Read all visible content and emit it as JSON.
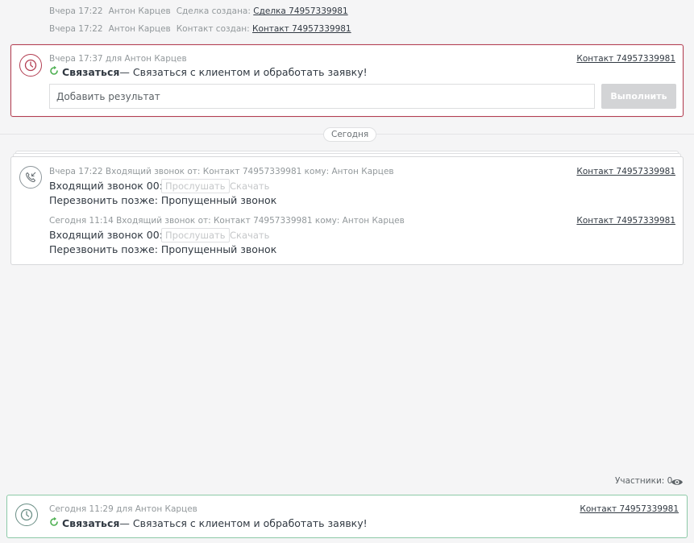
{
  "log": [
    {
      "time": "Вчера 17:22",
      "author": "Антон Карцев",
      "text": "Сделка создана:",
      "link": "Сделка 74957339981"
    },
    {
      "time": "Вчера 17:22",
      "author": "Антон Карцев",
      "text": "Контакт создан:",
      "link": "Контакт 74957339981"
    }
  ],
  "overdue_task": {
    "meta": "Вчера 17:37 для Антон Карцев",
    "contact": "Контакт 74957339981",
    "type": "Связаться",
    "text": " — Связаться с клиентом и обработать заявку!",
    "input_placeholder": "Добавить результат",
    "done_label": "Выполнить"
  },
  "date_separator": "Сегодня",
  "calls": [
    {
      "meta": "Вчера 17:22 Входящий звонок от: Контакт 74957339981 кому: Антон Карцев",
      "contact": "Контакт 74957339981",
      "line": "Входящий звонок 00:00",
      "listen": "Прослушать",
      "download": "Скачать",
      "result": "Перезвонить позже: Пропущенный звонок"
    },
    {
      "meta": "Сегодня 11:14 Входящий звонок от: Контакт 74957339981 кому: Антон Карцев",
      "contact": "Контакт 74957339981",
      "line": "Входящий звонок 00:00",
      "listen": "Прослушать",
      "download": "Скачать",
      "result": "Перезвонить позже: Пропущенный звонок"
    }
  ],
  "participants": "Участники: 0",
  "upcoming_task": {
    "meta": "Сегодня 11:29 для Антон Карцев",
    "contact": "Контакт 74957339981",
    "type": "Связаться",
    "text": " — Связаться с клиентом и обработать заявку!"
  },
  "colors": {
    "overdue_border": "#b33e52",
    "upcoming_border": "#8cc9a7",
    "spinner_green": "#4caf50"
  }
}
